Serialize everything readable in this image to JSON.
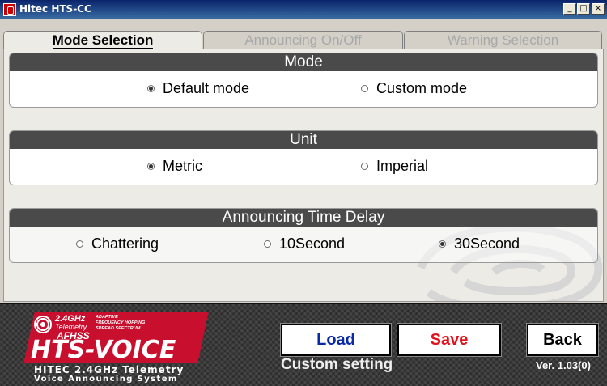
{
  "window": {
    "title": "Hitec HTS-CC",
    "controls": {
      "minimize": "_",
      "maximize": "□",
      "close": "×"
    }
  },
  "tabs": [
    {
      "label": "Mode Selection",
      "active": true
    },
    {
      "label": "Announcing On/Off",
      "active": false
    },
    {
      "label": "Warning Selection",
      "active": false
    }
  ],
  "groups": {
    "mode": {
      "title": "Mode",
      "options": [
        {
          "label": "Default mode",
          "selected": true
        },
        {
          "label": "Custom mode",
          "selected": false
        }
      ]
    },
    "unit": {
      "title": "Unit",
      "options": [
        {
          "label": "Metric",
          "selected": true
        },
        {
          "label": "Imperial",
          "selected": false
        }
      ]
    },
    "delay": {
      "title": "Announcing Time Delay",
      "options": [
        {
          "label": "Chattering",
          "selected": false
        },
        {
          "label": "10Second",
          "selected": false
        },
        {
          "label": "30Second",
          "selected": true
        }
      ]
    }
  },
  "logo": {
    "ghz": "2.4GHz",
    "telemetry": "Telemetry",
    "afhss": "AFHSS",
    "adaptive": "ADAPTIVE",
    "hopping": "FREQUENCY HOPPING",
    "spread": "SPREAD SPECTRUM",
    "name": "HTS-VOICE",
    "line1": "HITEC 2.4GHz Telemetry",
    "line2": "Voice Announcing System"
  },
  "buttons": {
    "load": "Load",
    "save": "Save",
    "back": "Back"
  },
  "status": "Custom setting",
  "version": "Ver. 1.03(0)",
  "colors": {
    "load_text": "#0a2aa8",
    "save_text": "#e0141e",
    "back_text": "#000000",
    "group_header": "#4a4a4a",
    "logo_red": "#c8102e"
  }
}
